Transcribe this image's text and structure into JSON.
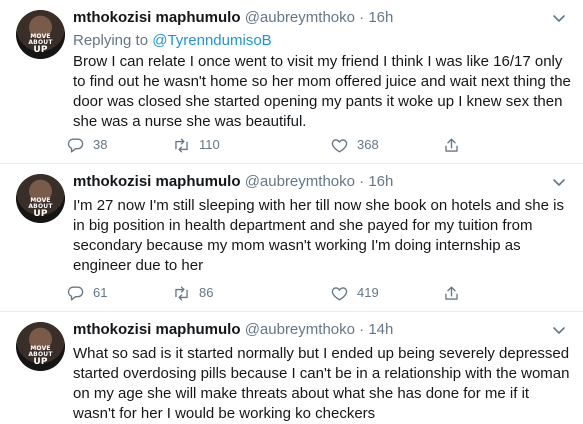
{
  "tweets": [
    {
      "name": "mthokozisi maphumulo",
      "handle": "@aubreymthoko",
      "dot": "·",
      "time": "16h",
      "replying_label": "Replying to",
      "replying_to": "@TyrenndumisoB",
      "text": "Brow I can relate I once went to visit my friend I think I was like 16/17 only to find out he wasn't home so her mom offered juice and wait next thing the door was closed she started opening my pants it woke up I knew sex then she was a nurse she was beautiful.",
      "replies": "38",
      "retweets": "110",
      "likes": "368"
    },
    {
      "name": "mthokozisi maphumulo",
      "handle": "@aubreymthoko",
      "dot": "·",
      "time": "16h",
      "text": "I'm 27 now I'm still sleeping with her till now she book on hotels and she is in big position in health department and she payed for my tuition from secondary because my mom wasn't working I'm doing internship as engineer due to her",
      "replies": "61",
      "retweets": "86",
      "likes": "419"
    },
    {
      "name": "mthokozisi maphumulo",
      "handle": "@aubreymthoko",
      "dot": "·",
      "time": "14h",
      "text": "What so sad is it started normally but I ended up being severely depressed started overdosing pills because I can't be in a relationship with the woman on my age she will make threats about what she has done for me if it wasn't for her I would be working ko checkers"
    }
  ],
  "avatar_text": {
    "line1": "MOVE",
    "line2": "ABOUT",
    "line3": "UP"
  },
  "icons": {
    "reply": "reply-icon",
    "retweet": "retweet-icon",
    "like": "heart-icon",
    "share": "share-icon",
    "caret": "chevron-down-icon"
  },
  "colors": {
    "text": "#14171a",
    "secondary": "#657786",
    "link": "#1b95e0",
    "divider": "#e6ecf0"
  }
}
